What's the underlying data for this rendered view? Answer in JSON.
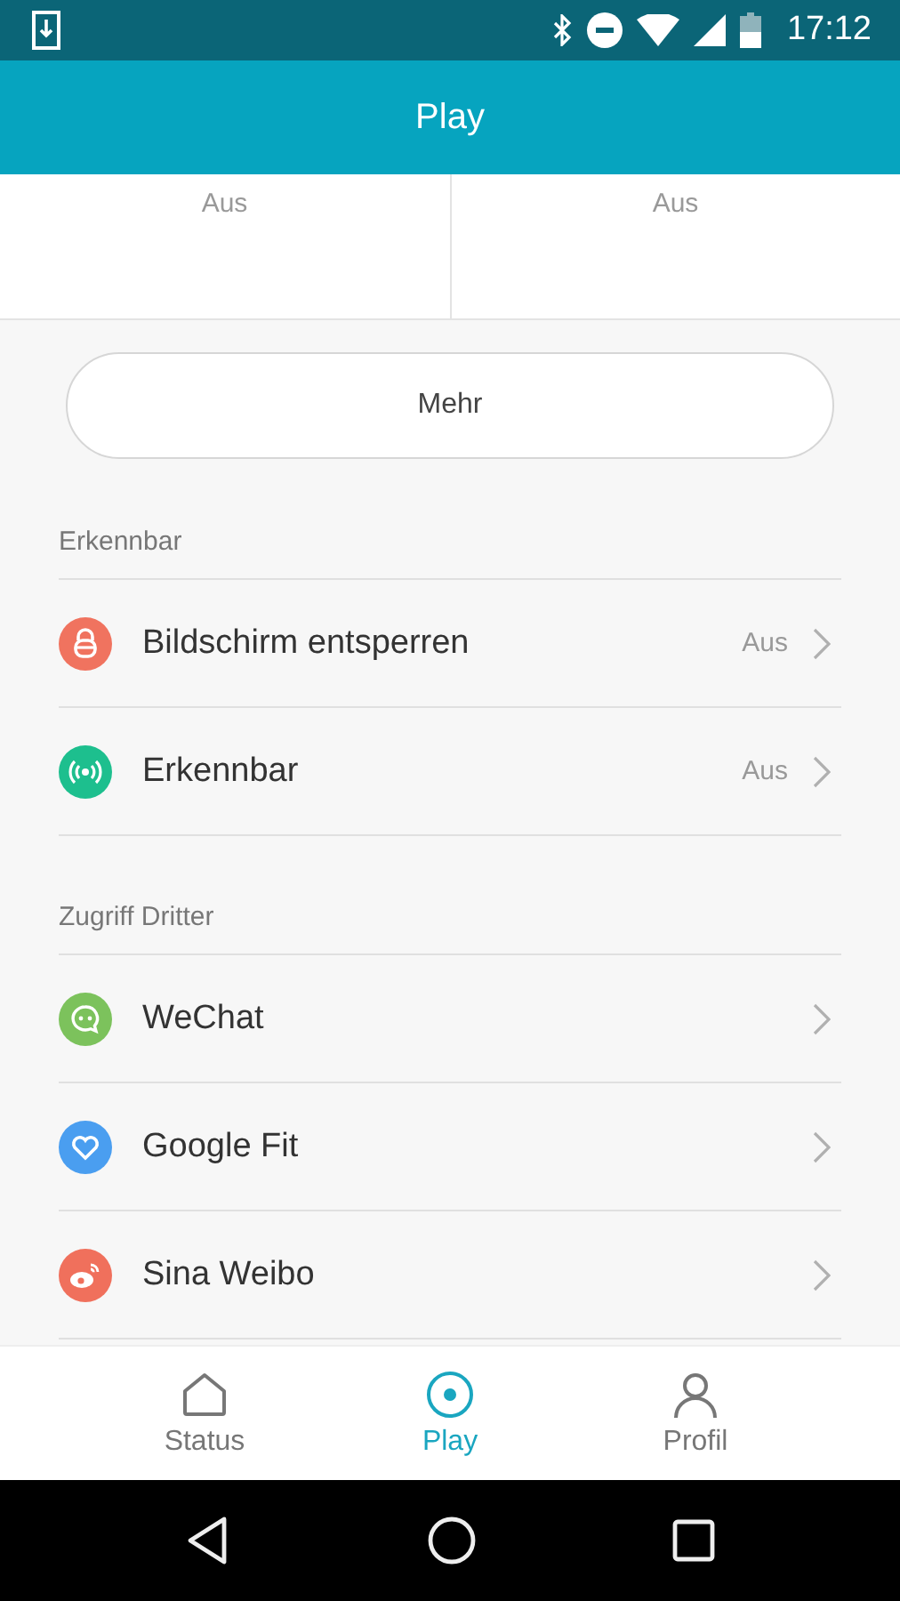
{
  "status_bar": {
    "time": "17:12"
  },
  "app_bar": {
    "title": "Play"
  },
  "tiles": [
    {
      "value": "Aus"
    },
    {
      "value": "Aus"
    }
  ],
  "more_button": {
    "label": "Mehr"
  },
  "sections": [
    {
      "title": "Erkennbar",
      "items": [
        {
          "label": "Bildschirm entsperren",
          "value": "Aus",
          "kind": "lock",
          "color": "#f0735f"
        },
        {
          "label": "Erkennbar",
          "value": "Aus",
          "kind": "signal",
          "color": "#1dbf8e"
        }
      ]
    },
    {
      "title": "Zugriff Dritter",
      "items": [
        {
          "label": "WeChat",
          "kind": "chat",
          "color": "#7cc25c"
        },
        {
          "label": "Google Fit",
          "kind": "heart",
          "color": "#4a9ef0"
        },
        {
          "label": "Sina Weibo",
          "kind": "weibo",
          "color": "#f0705c"
        }
      ]
    }
  ],
  "bottom_nav": [
    {
      "label": "Status",
      "kind": "home",
      "selected": false
    },
    {
      "label": "Play",
      "kind": "play",
      "selected": true
    },
    {
      "label": "Profil",
      "kind": "person",
      "selected": false
    }
  ]
}
